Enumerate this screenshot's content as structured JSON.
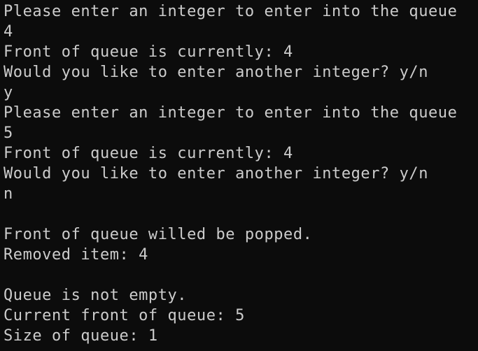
{
  "terminal": {
    "lines": [
      "Please enter an integer to enter into the queue",
      "4",
      "Front of queue is currently: 4",
      "Would you like to enter another integer? y/n",
      "y",
      "Please enter an integer to enter into the queue",
      "5",
      "Front of queue is currently: 4",
      "Would you like to enter another integer? y/n",
      "n",
      "",
      "Front of queue willed be popped.",
      "Removed item: 4",
      "",
      "Queue is not empty.",
      "Current front of queue: 5",
      "Size of queue: 1"
    ],
    "colors": {
      "background": "#0c0c0c",
      "foreground": "#cccccc"
    }
  }
}
